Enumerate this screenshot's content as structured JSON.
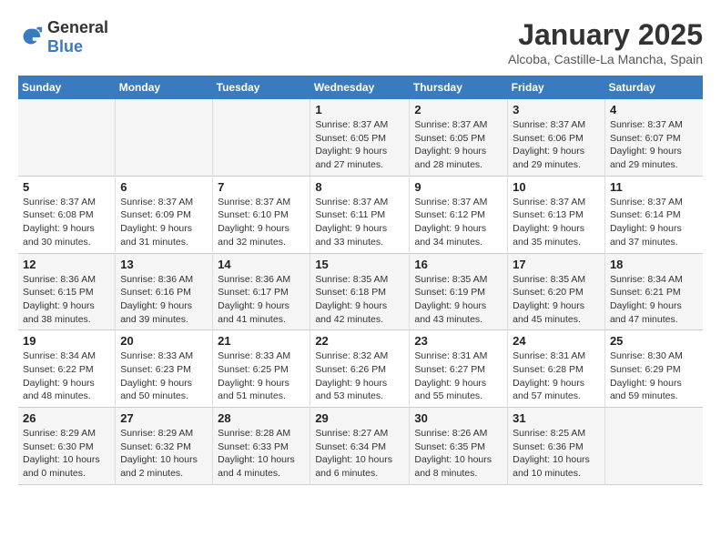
{
  "header": {
    "logo_general": "General",
    "logo_blue": "Blue",
    "title": "January 2025",
    "subtitle": "Alcoba, Castille-La Mancha, Spain"
  },
  "weekdays": [
    "Sunday",
    "Monday",
    "Tuesday",
    "Wednesday",
    "Thursday",
    "Friday",
    "Saturday"
  ],
  "weeks": [
    [
      {
        "day": "",
        "info": ""
      },
      {
        "day": "",
        "info": ""
      },
      {
        "day": "",
        "info": ""
      },
      {
        "day": "1",
        "info": "Sunrise: 8:37 AM\nSunset: 6:05 PM\nDaylight: 9 hours\nand 27 minutes."
      },
      {
        "day": "2",
        "info": "Sunrise: 8:37 AM\nSunset: 6:05 PM\nDaylight: 9 hours\nand 28 minutes."
      },
      {
        "day": "3",
        "info": "Sunrise: 8:37 AM\nSunset: 6:06 PM\nDaylight: 9 hours\nand 29 minutes."
      },
      {
        "day": "4",
        "info": "Sunrise: 8:37 AM\nSunset: 6:07 PM\nDaylight: 9 hours\nand 29 minutes."
      }
    ],
    [
      {
        "day": "5",
        "info": "Sunrise: 8:37 AM\nSunset: 6:08 PM\nDaylight: 9 hours\nand 30 minutes."
      },
      {
        "day": "6",
        "info": "Sunrise: 8:37 AM\nSunset: 6:09 PM\nDaylight: 9 hours\nand 31 minutes."
      },
      {
        "day": "7",
        "info": "Sunrise: 8:37 AM\nSunset: 6:10 PM\nDaylight: 9 hours\nand 32 minutes."
      },
      {
        "day": "8",
        "info": "Sunrise: 8:37 AM\nSunset: 6:11 PM\nDaylight: 9 hours\nand 33 minutes."
      },
      {
        "day": "9",
        "info": "Sunrise: 8:37 AM\nSunset: 6:12 PM\nDaylight: 9 hours\nand 34 minutes."
      },
      {
        "day": "10",
        "info": "Sunrise: 8:37 AM\nSunset: 6:13 PM\nDaylight: 9 hours\nand 35 minutes."
      },
      {
        "day": "11",
        "info": "Sunrise: 8:37 AM\nSunset: 6:14 PM\nDaylight: 9 hours\nand 37 minutes."
      }
    ],
    [
      {
        "day": "12",
        "info": "Sunrise: 8:36 AM\nSunset: 6:15 PM\nDaylight: 9 hours\nand 38 minutes."
      },
      {
        "day": "13",
        "info": "Sunrise: 8:36 AM\nSunset: 6:16 PM\nDaylight: 9 hours\nand 39 minutes."
      },
      {
        "day": "14",
        "info": "Sunrise: 8:36 AM\nSunset: 6:17 PM\nDaylight: 9 hours\nand 41 minutes."
      },
      {
        "day": "15",
        "info": "Sunrise: 8:35 AM\nSunset: 6:18 PM\nDaylight: 9 hours\nand 42 minutes."
      },
      {
        "day": "16",
        "info": "Sunrise: 8:35 AM\nSunset: 6:19 PM\nDaylight: 9 hours\nand 43 minutes."
      },
      {
        "day": "17",
        "info": "Sunrise: 8:35 AM\nSunset: 6:20 PM\nDaylight: 9 hours\nand 45 minutes."
      },
      {
        "day": "18",
        "info": "Sunrise: 8:34 AM\nSunset: 6:21 PM\nDaylight: 9 hours\nand 47 minutes."
      }
    ],
    [
      {
        "day": "19",
        "info": "Sunrise: 8:34 AM\nSunset: 6:22 PM\nDaylight: 9 hours\nand 48 minutes."
      },
      {
        "day": "20",
        "info": "Sunrise: 8:33 AM\nSunset: 6:23 PM\nDaylight: 9 hours\nand 50 minutes."
      },
      {
        "day": "21",
        "info": "Sunrise: 8:33 AM\nSunset: 6:25 PM\nDaylight: 9 hours\nand 51 minutes."
      },
      {
        "day": "22",
        "info": "Sunrise: 8:32 AM\nSunset: 6:26 PM\nDaylight: 9 hours\nand 53 minutes."
      },
      {
        "day": "23",
        "info": "Sunrise: 8:31 AM\nSunset: 6:27 PM\nDaylight: 9 hours\nand 55 minutes."
      },
      {
        "day": "24",
        "info": "Sunrise: 8:31 AM\nSunset: 6:28 PM\nDaylight: 9 hours\nand 57 minutes."
      },
      {
        "day": "25",
        "info": "Sunrise: 8:30 AM\nSunset: 6:29 PM\nDaylight: 9 hours\nand 59 minutes."
      }
    ],
    [
      {
        "day": "26",
        "info": "Sunrise: 8:29 AM\nSunset: 6:30 PM\nDaylight: 10 hours\nand 0 minutes."
      },
      {
        "day": "27",
        "info": "Sunrise: 8:29 AM\nSunset: 6:32 PM\nDaylight: 10 hours\nand 2 minutes."
      },
      {
        "day": "28",
        "info": "Sunrise: 8:28 AM\nSunset: 6:33 PM\nDaylight: 10 hours\nand 4 minutes."
      },
      {
        "day": "29",
        "info": "Sunrise: 8:27 AM\nSunset: 6:34 PM\nDaylight: 10 hours\nand 6 minutes."
      },
      {
        "day": "30",
        "info": "Sunrise: 8:26 AM\nSunset: 6:35 PM\nDaylight: 10 hours\nand 8 minutes."
      },
      {
        "day": "31",
        "info": "Sunrise: 8:25 AM\nSunset: 6:36 PM\nDaylight: 10 hours\nand 10 minutes."
      },
      {
        "day": "",
        "info": ""
      }
    ]
  ]
}
